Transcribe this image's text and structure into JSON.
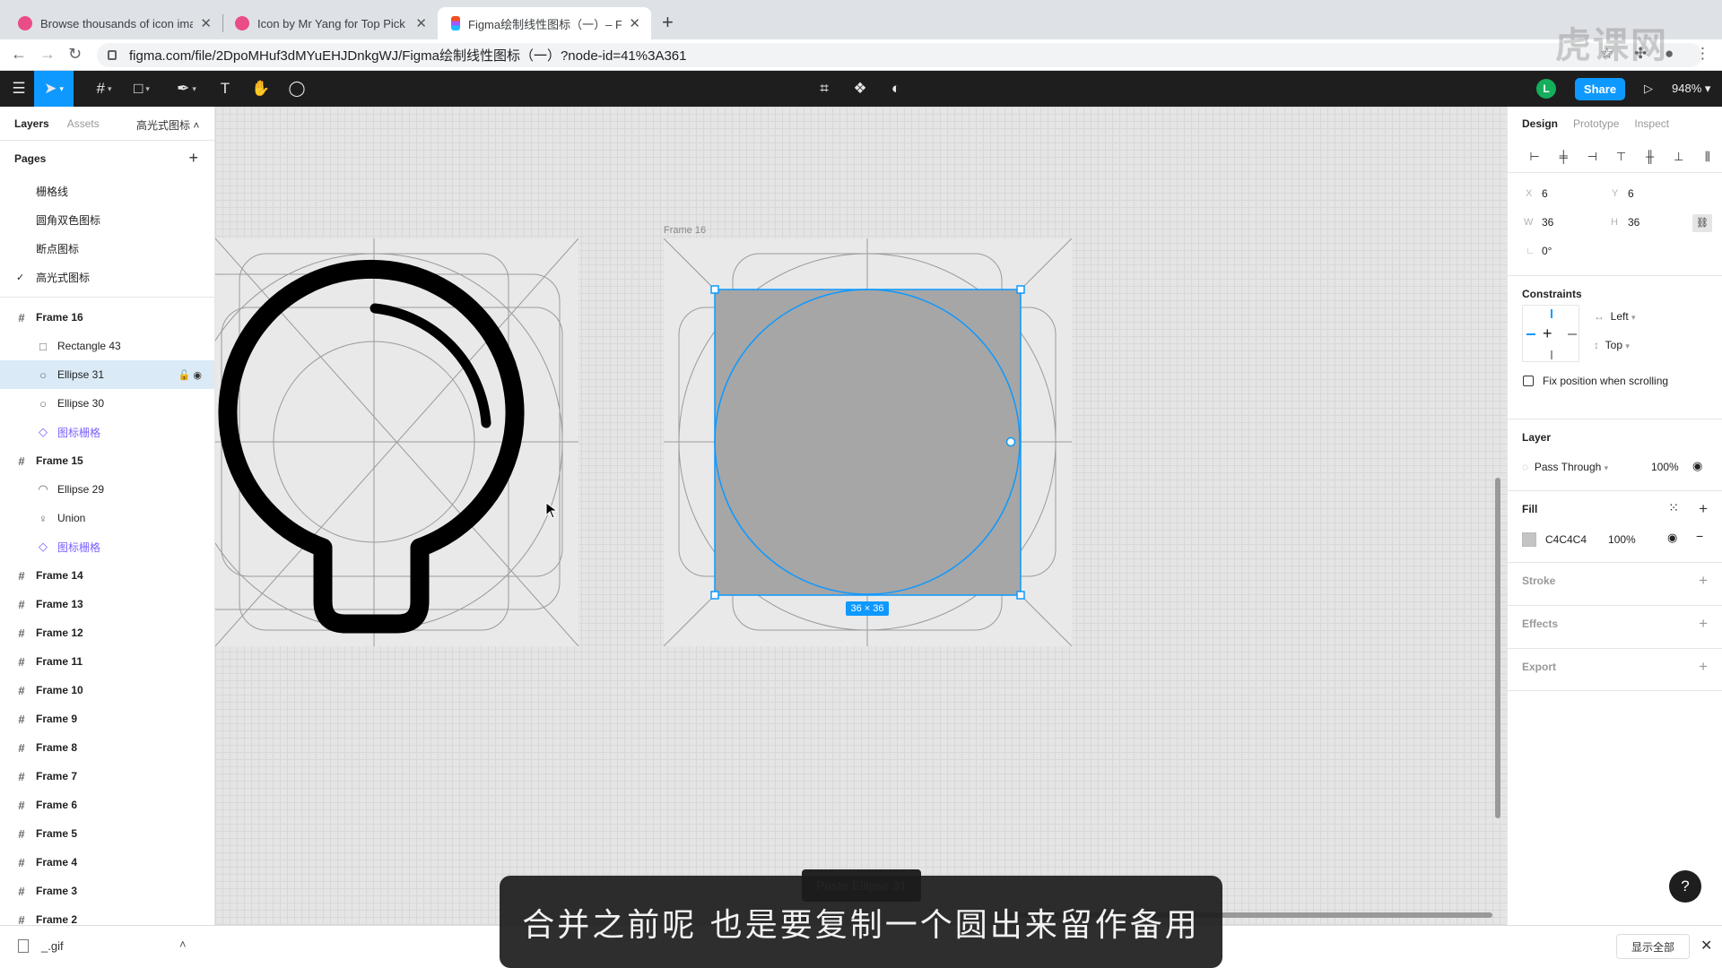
{
  "browser": {
    "tabs": [
      {
        "title": "Browse thousands of icon imag",
        "favicon_color": "#ea4c89",
        "active": false
      },
      {
        "title": "Icon by Mr Yang for Top Pick S",
        "favicon_color": "#ea4c89",
        "active": false
      },
      {
        "title": "Figma绘制线性图标（一）– Fig",
        "favicon_color": "#f24e1e",
        "active": true
      }
    ],
    "url": "figma.com/file/2DpoMHuf3dMYuEHJDnkgWJ/Figma绘制线性图标（一）?node-id=41%3A361",
    "watermark": "虎课网"
  },
  "toolbar": {
    "avatar_letter": "L",
    "share_label": "Share",
    "zoom": "948%"
  },
  "left_panel": {
    "tabs": [
      "Layers",
      "Assets"
    ],
    "current_page": "高光式图标",
    "pages_title": "Pages",
    "pages": [
      {
        "name": "栅格线",
        "checked": false
      },
      {
        "name": "圆角双色图标",
        "checked": false
      },
      {
        "name": "断点图标",
        "checked": false
      },
      {
        "name": "高光式图标",
        "checked": true
      }
    ],
    "layers": [
      {
        "name": "Frame 16",
        "kind": "frame",
        "icon": "#"
      },
      {
        "name": "Rectangle 43",
        "kind": "child",
        "icon": "□"
      },
      {
        "name": "Ellipse 31",
        "kind": "child",
        "icon": "○",
        "selected": true
      },
      {
        "name": "Ellipse 30",
        "kind": "child",
        "icon": "○"
      },
      {
        "name": "图标栅格",
        "kind": "child",
        "icon": "◇",
        "component": true
      },
      {
        "name": "Frame 15",
        "kind": "frame",
        "icon": "#"
      },
      {
        "name": "Ellipse 29",
        "kind": "child",
        "icon": "◠"
      },
      {
        "name": "Union",
        "kind": "child",
        "icon": "♀"
      },
      {
        "name": "图标栅格",
        "kind": "child",
        "icon": "◇",
        "component": true
      },
      {
        "name": "Frame 14",
        "kind": "frame",
        "icon": "#"
      },
      {
        "name": "Frame 13",
        "kind": "frame",
        "icon": "#"
      },
      {
        "name": "Frame 12",
        "kind": "frame",
        "icon": "#"
      },
      {
        "name": "Frame 11",
        "kind": "frame",
        "icon": "#"
      },
      {
        "name": "Frame 10",
        "kind": "frame",
        "icon": "#"
      },
      {
        "name": "Frame 9",
        "kind": "frame",
        "icon": "#"
      },
      {
        "name": "Frame 8",
        "kind": "frame",
        "icon": "#"
      },
      {
        "name": "Frame 7",
        "kind": "frame",
        "icon": "#"
      },
      {
        "name": "Frame 6",
        "kind": "frame",
        "icon": "#"
      },
      {
        "name": "Frame 5",
        "kind": "frame",
        "icon": "#"
      },
      {
        "name": "Frame 4",
        "kind": "frame",
        "icon": "#"
      },
      {
        "name": "Frame 3",
        "kind": "frame",
        "icon": "#"
      },
      {
        "name": "Frame 2",
        "kind": "frame",
        "icon": "#"
      }
    ]
  },
  "canvas": {
    "frame_label": "Frame 16",
    "size_badge": "36 × 36",
    "selection_color": "#0d99ff",
    "fill_color": "#a6a6a6"
  },
  "right_panel": {
    "tabs": [
      "Design",
      "Prototype",
      "Inspect"
    ],
    "x_label": "X",
    "x": "6",
    "y_label": "Y",
    "y": "6",
    "w_label": "W",
    "w": "36",
    "h_label": "H",
    "h": "36",
    "rotation": "0°",
    "constraints_title": "Constraints",
    "constraint_h": "Left",
    "constraint_v": "Top",
    "fix_scroll": "Fix position when scrolling",
    "layer_title": "Layer",
    "blend": "Pass Through",
    "layer_opacity": "100%",
    "fill_title": "Fill",
    "fill_hex": "C4C4C4",
    "fill_opacity": "100%",
    "stroke_title": "Stroke",
    "effects_title": "Effects",
    "export_title": "Export"
  },
  "toast": "Paste Ellipse 31",
  "subtitle": "合并之前呢  也是要复制一个圆出来留作备用",
  "download": {
    "file": "_.gif",
    "show_all": "显示全部"
  }
}
